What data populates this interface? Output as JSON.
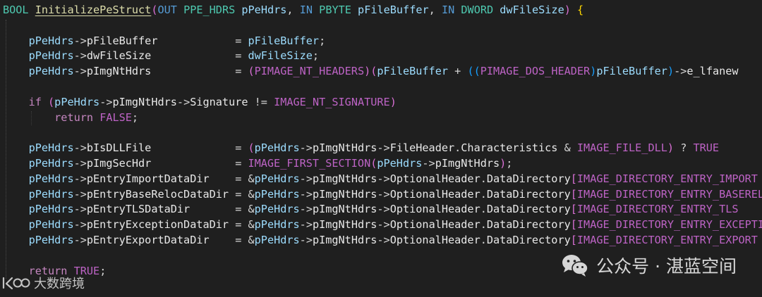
{
  "editor": {
    "signature": {
      "ret": "BOOL",
      "name": "InitializePeStruct",
      "lp": "(",
      "m1": "OUT",
      "t1": "PPE_HDRS",
      "p1": "pPeHdrs",
      "c1": ",",
      "m2": "IN",
      "t2": "PBYTE",
      "p2": "pFileBuffer",
      "c2": ",",
      "m3": "IN",
      "t3": "DWORD",
      "p3": "dwFileSize",
      "rp": ")",
      "brace": "{"
    },
    "assign_pfilebuffer": {
      "obj": "pPeHdrs",
      "arrow": "->",
      "field": "pFileBuffer",
      "pad": "            = ",
      "value": "pFileBuffer",
      "end": ";"
    },
    "assign_dwfilesize": {
      "obj": "pPeHdrs",
      "arrow": "->",
      "field": "dwFileSize",
      "pad": "             = ",
      "value": "dwFileSize",
      "end": ";"
    },
    "assign_pimgnthdrs": {
      "obj": "pPeHdrs",
      "arrow": "->",
      "field": "pImgNtHdrs",
      "pad": "             = ",
      "lp1": "(",
      "cast1": "PIMAGE_NT_HEADERS",
      "rp1": ")",
      "lp2": "(",
      "v1": "pFileBuffer",
      "plus": " + ",
      "lp3": "((",
      "cast2": "PIMAGE_DOS_HEADER",
      "rp3": ")",
      "v2": "pFileBuffer",
      "rp4": ")",
      "arrow2": "->",
      "tail": "e_lfanew"
    },
    "if_signature": {
      "kw": "if",
      "lp": " (",
      "obj": "pPeHdrs",
      "arrow1": "->",
      "f1": "pImgNtHdrs",
      "arrow2": "->",
      "f2": "Signature",
      "op": " != ",
      "macro": "IMAGE_NT_SIGNATURE",
      "rp": ")"
    },
    "return_false": {
      "kw": "return",
      "val": "FALSE",
      "end": ";"
    },
    "assign_bisdllfile": {
      "obj": "pPeHdrs",
      "arrow": "->",
      "field": "bIsDLLFile",
      "pad": "             = ",
      "lp": "(",
      "v1": "pPeHdrs",
      "a1": "->",
      "f1": "pImgNtHdrs",
      "a2": "->",
      "f2": "FileHeader",
      "dot": ".",
      "f3": "Characteristics",
      "op": " & ",
      "macro": "IMAGE_FILE_DLL",
      "rp": ")",
      "tern": " ? ",
      "val": "TRUE"
    },
    "assign_pimgsechdr": {
      "obj": "pPeHdrs",
      "arrow": "->",
      "field": "pImgSecHdr",
      "pad": "             = ",
      "macro": "IMAGE_FIRST_SECTION",
      "lp": "(",
      "v1": "pPeHdrs",
      "a1": "->",
      "f1": "pImgNtHdrs",
      "rp": ")",
      "end": ";"
    },
    "datadir_rows": [
      {
        "obj": "pPeHdrs",
        "arrow": "->",
        "field": "pEntryImportDataDir",
        "pad": "    = ",
        "amp": "&",
        "v1": "pPeHdrs",
        "a1": "->",
        "f1": "pImgNtHdrs",
        "a2": "->",
        "f2": "OptionalHeader",
        "dot": ".",
        "f3": "DataDirectory",
        "lb": "[",
        "macro": "IMAGE_DIRECTORY_ENTRY_IMPORT"
      },
      {
        "obj": "pPeHdrs",
        "arrow": "->",
        "field": "pEntryBaseRelocDataDir",
        "pad": " = ",
        "amp": "&",
        "v1": "pPeHdrs",
        "a1": "->",
        "f1": "pImgNtHdrs",
        "a2": "->",
        "f2": "OptionalHeader",
        "dot": ".",
        "f3": "DataDirectory",
        "lb": "[",
        "macro": "IMAGE_DIRECTORY_ENTRY_BASERELOC"
      },
      {
        "obj": "pPeHdrs",
        "arrow": "->",
        "field": "pEntryTLSDataDir",
        "pad": "       = ",
        "amp": "&",
        "v1": "pPeHdrs",
        "a1": "->",
        "f1": "pImgNtHdrs",
        "a2": "->",
        "f2": "OptionalHeader",
        "dot": ".",
        "f3": "DataDirectory",
        "lb": "[",
        "macro": "IMAGE_DIRECTORY_ENTRY_TLS"
      },
      {
        "obj": "pPeHdrs",
        "arrow": "->",
        "field": "pEntryExceptionDataDir",
        "pad": " = ",
        "amp": "&",
        "v1": "pPeHdrs",
        "a1": "->",
        "f1": "pImgNtHdrs",
        "a2": "->",
        "f2": "OptionalHeader",
        "dot": ".",
        "f3": "DataDirectory",
        "lb": "[",
        "macro": "IMAGE_DIRECTORY_ENTRY_EXCEPTION"
      },
      {
        "obj": "pPeHdrs",
        "arrow": "->",
        "field": "pEntryExportDataDir",
        "pad": "    = ",
        "amp": "&",
        "v1": "pPeHdrs",
        "a1": "->",
        "f1": "pImgNtHdrs",
        "a2": "->",
        "f2": "OptionalHeader",
        "dot": ".",
        "f3": "DataDirectory",
        "lb": "[",
        "macro": "IMAGE_DIRECTORY_ENTRY_EXPORT"
      }
    ],
    "return_true": {
      "kw": "return",
      "val": "TRUE",
      "end": ";"
    }
  },
  "watermark": {
    "icon": "wechat-icon",
    "text": "公众号 · 湛蓝空间"
  },
  "corner_mark": {
    "logo": "brand-logo",
    "text": "大数跨境"
  },
  "colors": {
    "background": "#1f1f1f",
    "keyword": "#569cd6",
    "control": "#c586c0",
    "type": "#4ec9b0",
    "macro": "#bd63c5",
    "function": "#dcdcaa",
    "variable": "#9cdcfe",
    "brace": "#ffd700"
  }
}
